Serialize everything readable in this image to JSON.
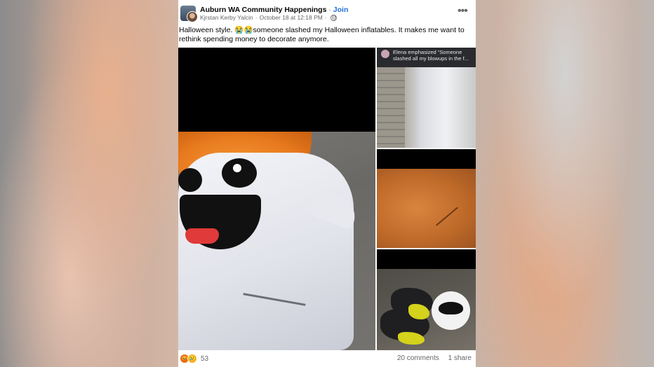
{
  "post": {
    "group_name": "Auburn WA Community Happenings",
    "separator": " · ",
    "join_label": "Join",
    "author": "Kjrstan Kerby Yalcin",
    "date": "October 18 at 12:18 PM",
    "text": "Halloween style. 😭😭someone slashed my Halloween inflatables.  It makes me want to rethink spending money to decorate anymore."
  },
  "notification": {
    "text_line1": "Elena emphasized “Someone",
    "text_line2": "slashed all my blowups in the f..."
  },
  "footer": {
    "reaction_count": "53",
    "comments": "20 comments",
    "shares": "1 share"
  },
  "icons": {
    "more": "more-options-icon",
    "privacy": "globe-icon",
    "reactions": [
      "angry-reaction-icon",
      "sad-reaction-icon"
    ]
  },
  "colors": {
    "accent": "#216fdb",
    "angry": "#e9710f",
    "sad": "#f7b125"
  }
}
